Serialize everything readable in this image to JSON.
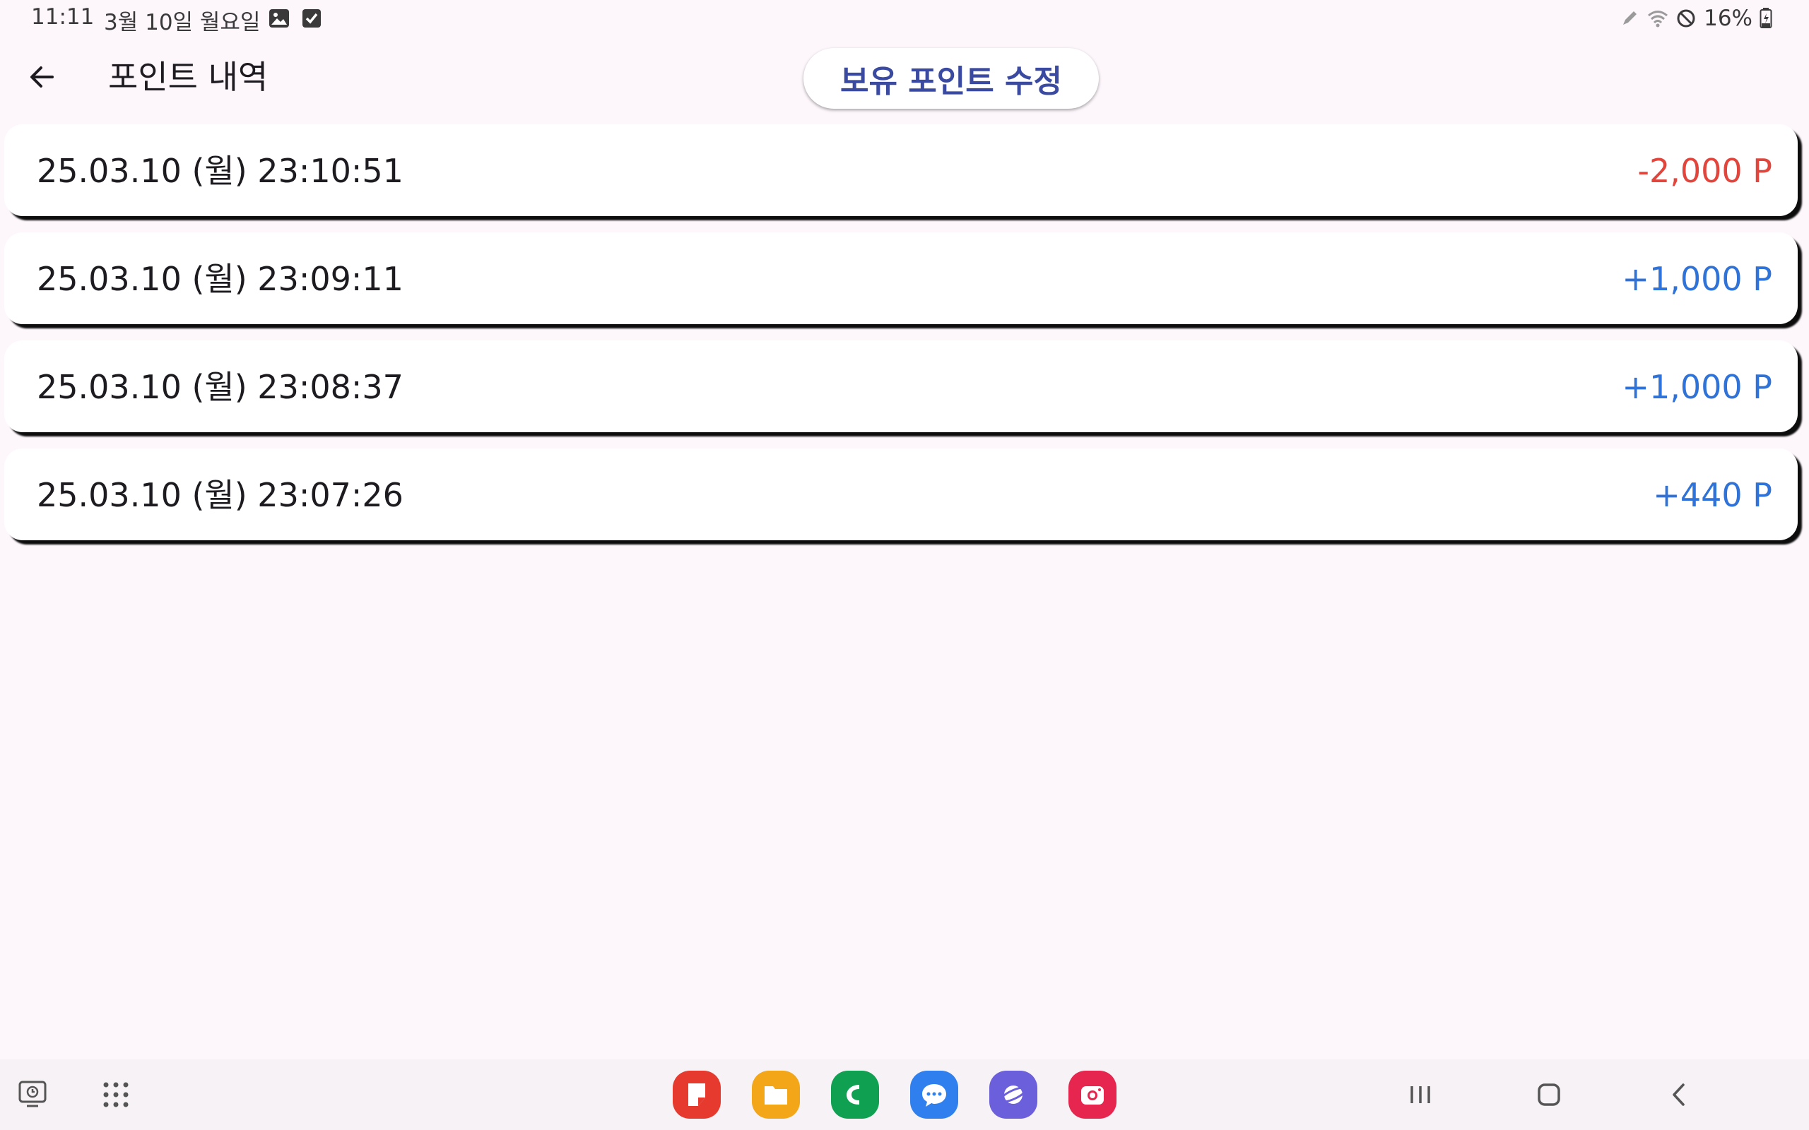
{
  "status_bar": {
    "time": "11:11",
    "date": "3월 10일 월요일",
    "notification_icons": [
      "gallery-icon",
      "checkbox-icon"
    ],
    "system_icons": [
      "pen-icon",
      "wifi-icon",
      "do-not-disturb-icon"
    ],
    "battery": "16%"
  },
  "app_bar": {
    "title": "포인트 내역",
    "edit_button_label": "보유 포인트 수정"
  },
  "colors": {
    "negative": "#e2453c",
    "positive": "#2f72d8",
    "background": "#fdf7fc",
    "accent": "#3a4aa0"
  },
  "history": [
    {
      "datetime": "25.03.10 (월) 23:10:51",
      "points": "-2,000 P",
      "type": "negative"
    },
    {
      "datetime": "25.03.10 (월) 23:09:11",
      "points": "+1,000 P",
      "type": "positive"
    },
    {
      "datetime": "25.03.10 (월) 23:08:37",
      "points": "+1,000 P",
      "type": "positive"
    },
    {
      "datetime": "25.03.10 (월) 23:07:26",
      "points": "+440 P",
      "type": "positive"
    }
  ],
  "taskbar": {
    "dock_apps": [
      {
        "name": "notes-app",
        "color": "#e63a2e"
      },
      {
        "name": "my-files-app",
        "color": "#f2a618"
      },
      {
        "name": "phone-app",
        "color": "#10a052"
      },
      {
        "name": "messages-app",
        "color": "#2f80ee"
      },
      {
        "name": "internet-app",
        "color": "#6b5fdb"
      },
      {
        "name": "camera-app",
        "color": "#e6264f"
      }
    ]
  }
}
